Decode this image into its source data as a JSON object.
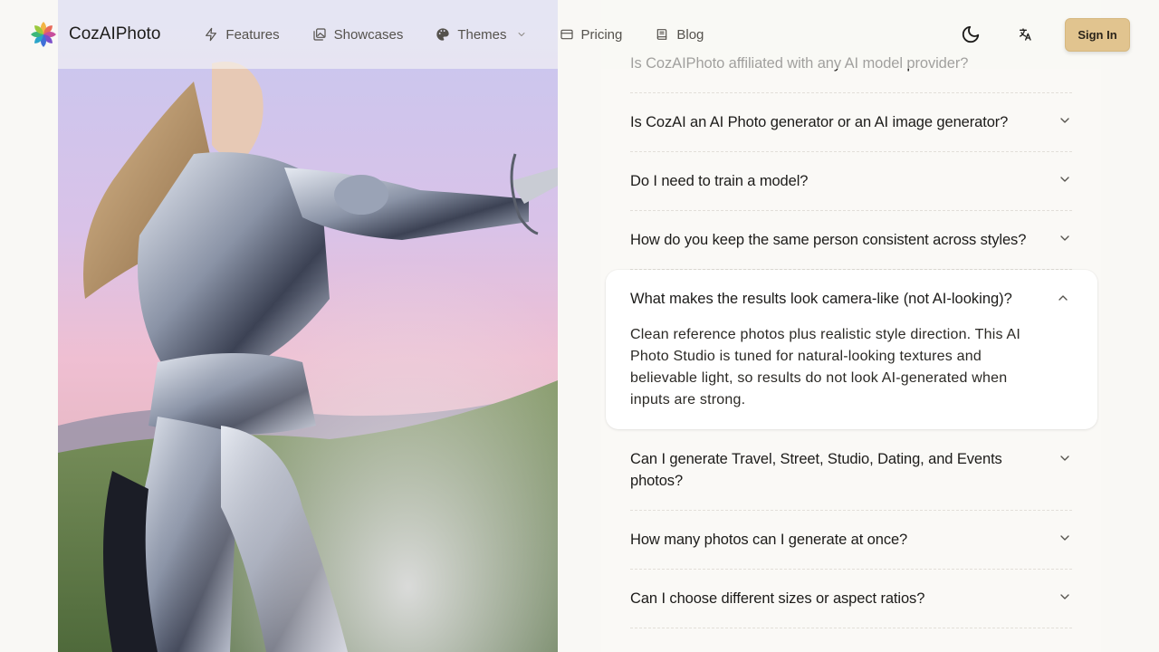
{
  "brand": {
    "name": "CozAIPhoto"
  },
  "nav": [
    {
      "label": "Features",
      "icon": "lightning-icon"
    },
    {
      "label": "Showcases",
      "icon": "images-icon"
    },
    {
      "label": "Themes",
      "icon": "palette-icon",
      "dropdown": true
    },
    {
      "label": "Pricing",
      "icon": "credit-card-icon"
    },
    {
      "label": "Blog",
      "icon": "book-icon"
    }
  ],
  "header": {
    "signin_label": "Sign In"
  },
  "colors": {
    "accent": "#e1c48f",
    "background": "#f9f8f5"
  },
  "faq": {
    "items": [
      {
        "question": "Is CozAIPhoto affiliated with any AI model provider?"
      },
      {
        "question": "Is CozAI an AI Photo generator or an AI image generator?"
      },
      {
        "question": "Do I need to train a model?"
      },
      {
        "question": "How do you keep the same person consistent across styles?"
      },
      {
        "question": "What makes the results look camera-like (not AI-looking)?",
        "answer": "Clean reference photos plus realistic style direction. This AI Photo Studio is tuned for natural-looking textures and believable light, so results do not look AI-generated when inputs are strong.",
        "open": true
      },
      {
        "question": "Can I generate Travel, Street, Studio, Dating, and Events photos?"
      },
      {
        "question": "How many photos can I generate at once?"
      },
      {
        "question": "Can I choose different sizes or aspect ratios?"
      }
    ]
  }
}
